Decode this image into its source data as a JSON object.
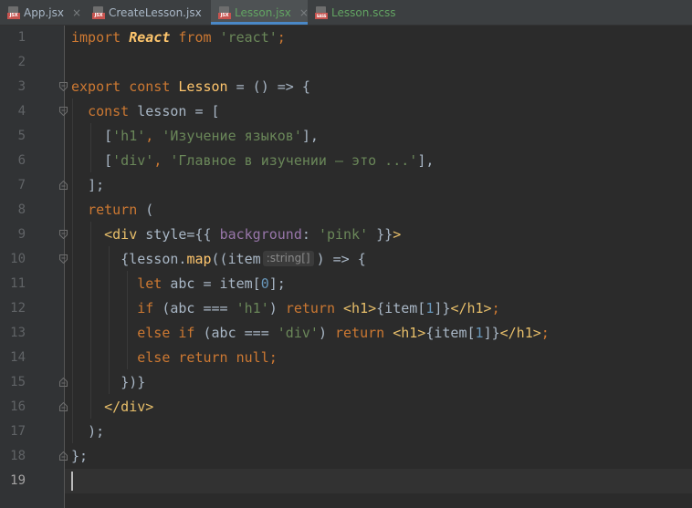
{
  "tabs": [
    {
      "label": "App.jsx",
      "icon": "jsx-file-icon",
      "badge": "JSX",
      "active": false,
      "color": "#a9b7c6"
    },
    {
      "label": "CreateLesson.jsx",
      "icon": "jsx-file-icon",
      "badge": "JSX",
      "active": false,
      "color": "#a9b7c6"
    },
    {
      "label": "Lesson.jsx",
      "icon": "jsx-file-icon",
      "badge": "JSX",
      "active": true,
      "color": "#62a362"
    },
    {
      "label": "Lesson.scss",
      "icon": "sass-file-icon",
      "badge": "SASS",
      "active": false,
      "color": "#62a362"
    }
  ],
  "close_glyph": "×",
  "line_numbers": [
    "1",
    "2",
    "3",
    "4",
    "5",
    "6",
    "7",
    "8",
    "9",
    "10",
    "11",
    "12",
    "13",
    "14",
    "15",
    "16",
    "17",
    "18",
    "19"
  ],
  "current_line": 19,
  "code": {
    "l1": {
      "import": "import",
      "react": "React",
      "from": "from",
      "module": "'react'",
      "semi": ";"
    },
    "l3": {
      "export": "export",
      "const": "const",
      "name": "Lesson",
      "rest": " = () => {"
    },
    "l4": {
      "const": "const",
      "rest": " lesson = ["
    },
    "l5": {
      "open": "[",
      "s1": "'h1'",
      "comma": ", ",
      "s2": "'Изучение языков'",
      "close": "],"
    },
    "l6": {
      "open": "[",
      "s1": "'div'",
      "comma": ", ",
      "s2": "'Главное в изучении — это ...'",
      "close": "],"
    },
    "l7": {
      "text": "];"
    },
    "l8": {
      "ret": "return",
      "rest": " ("
    },
    "l9": {
      "tag_open": "<div",
      "attr": " style={{ ",
      "prop": "background",
      "colon": ": ",
      "val": "'pink'",
      "end": " }}",
      "gt": ">"
    },
    "l10": {
      "a": "{lesson.",
      "fn": "map",
      "b": "((item",
      "hint": ":string[]",
      "c": ") => {"
    },
    "l11": {
      "let": "let",
      "a": " abc = item[",
      "n": "0",
      "b": "];"
    },
    "l12": {
      "if": "if",
      "a": " (abc === ",
      "s": "'h1'",
      "b": ") ",
      "ret": "return",
      "t1": " <h1>",
      "c": "{item[",
      "n": "1",
      "d": "]}",
      "t2": "</h1>",
      "semi": ";"
    },
    "l13": {
      "else": "else",
      "if": " if",
      "a": " (abc === ",
      "s": "'div'",
      "b": ") ",
      "ret": "return",
      "t1": " <h1>",
      "c": "{item[",
      "n": "1",
      "d": "]}",
      "t2": "</h1>",
      "semi": ";"
    },
    "l14": {
      "else": "else",
      "ret": " return",
      "nul": " null",
      "semi": ";"
    },
    "l15": {
      "text": "})}"
    },
    "l16": {
      "tag": "</div>"
    },
    "l17": {
      "text": ");"
    },
    "l18": {
      "text": "};"
    }
  },
  "colors": {
    "background": "#2b2b2b",
    "gutter": "#313335",
    "keyword": "#cc7832",
    "string": "#6a8759",
    "number": "#6897bb",
    "tag": "#e8bf6a",
    "property": "#9876aa",
    "function": "#ffc66d",
    "active_tab_underline": "#4a88c7"
  }
}
